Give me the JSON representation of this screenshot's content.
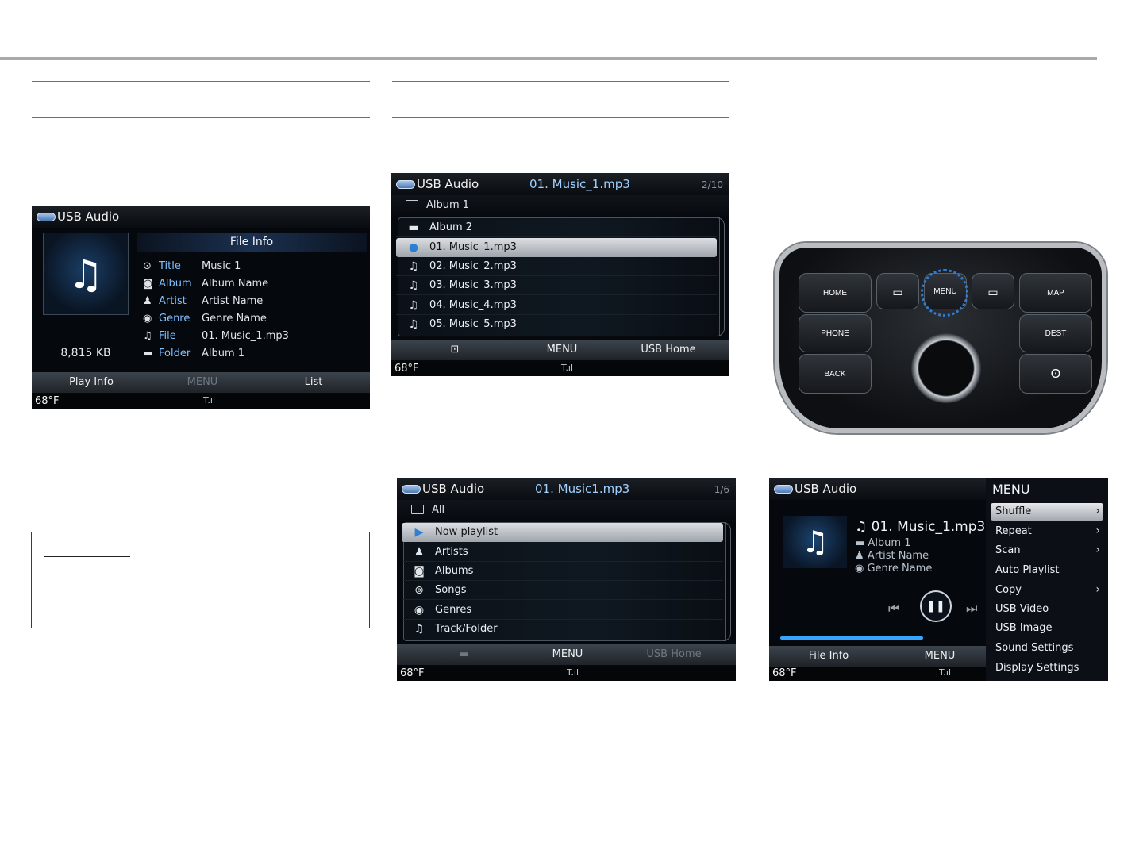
{
  "panel_file_info": {
    "source": "USB Audio",
    "file_size": "8,815 KB",
    "heading": "File Info",
    "rows": [
      {
        "icon": "title-icon",
        "label": "Title",
        "value": "Music 1"
      },
      {
        "icon": "album-icon",
        "label": "Album",
        "value": "Album Name"
      },
      {
        "icon": "artist-icon",
        "label": "Artist",
        "value": "Artist Name"
      },
      {
        "icon": "genre-icon",
        "label": "Genre",
        "value": "Genre Name"
      },
      {
        "icon": "music-note-icon",
        "label": "File",
        "value": "01. Music_1.mp3"
      },
      {
        "icon": "folder-icon",
        "label": "Folder",
        "value": "Album 1"
      }
    ],
    "softkeys": {
      "left": "Play Info",
      "center": "MENU",
      "right": "List"
    },
    "temperature": "68°F"
  },
  "panel_list": {
    "source": "USB Audio",
    "track": "01. Music_1.mp3",
    "count": "2/10",
    "path": "Album 1",
    "rows": [
      {
        "icon": "folder-icon",
        "label": "Album 2"
      },
      {
        "icon": "play-icon",
        "label": "01. Music_1.mp3"
      },
      {
        "icon": "music-note-icon",
        "label": "02. Music_2.mp3"
      },
      {
        "icon": "music-note-icon",
        "label": "03. Music_3.mp3"
      },
      {
        "icon": "music-note-icon",
        "label": "04. Music_4.mp3"
      },
      {
        "icon": "music-note-icon",
        "label": "05. Music_5.mp3"
      }
    ],
    "softkeys": {
      "center": "MENU",
      "right": "USB Home"
    },
    "temperature": "68°F"
  },
  "panel_category": {
    "source": "USB Audio",
    "track": "01. Music1.mp3",
    "count": "1/6",
    "path": "All",
    "rows": [
      {
        "icon": "now-playlist-icon",
        "label": "Now playlist"
      },
      {
        "icon": "artist-icon",
        "label": "Artists"
      },
      {
        "icon": "album-icon",
        "label": "Albums"
      },
      {
        "icon": "songs-icon",
        "label": "Songs"
      },
      {
        "icon": "genre-icon",
        "label": "Genres"
      },
      {
        "icon": "music-note-icon",
        "label": "Track/Folder"
      }
    ],
    "softkeys": {
      "center": "MENU",
      "right": "USB Home"
    },
    "temperature": "68°F"
  },
  "panel_menu": {
    "source": "USB Audio",
    "track": "01. Music_1.mp3",
    "album": "Album 1",
    "artist": "Artist Name",
    "genre": "Genre Name",
    "menu_title": "MENU",
    "menu_items": [
      {
        "label": "Shuffle",
        "arrow": "›"
      },
      {
        "label": "Repeat",
        "arrow": "›"
      },
      {
        "label": "Scan",
        "arrow": "›"
      },
      {
        "label": "Auto Playlist",
        "arrow": ""
      },
      {
        "label": "Copy",
        "arrow": "›"
      },
      {
        "label": "USB Video",
        "arrow": ""
      },
      {
        "label": "USB Image",
        "arrow": ""
      },
      {
        "label": "Sound Settings",
        "arrow": ""
      },
      {
        "label": "Display Settings",
        "arrow": ""
      }
    ],
    "softkeys": {
      "left": "File Info",
      "center": "MENU"
    },
    "temperature": "68°F"
  },
  "hardware": {
    "buttons": {
      "home": "HOME",
      "phone": "PHONE",
      "back": "BACK",
      "menu": "MENU",
      "map": "MAP",
      "dest": "DEST"
    }
  }
}
